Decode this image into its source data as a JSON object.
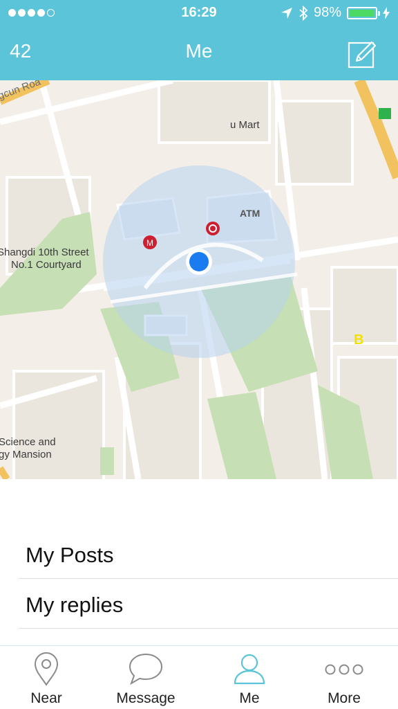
{
  "status_bar": {
    "time": "16:29",
    "battery": "98%",
    "battery_level": 0.98,
    "signal_dots_filled": 4,
    "signal_dots_total": 5,
    "icons": [
      "location-arrow-icon",
      "bluetooth-icon",
      "battery-icon",
      "charging-icon"
    ]
  },
  "nav": {
    "count": "42",
    "title": "Me",
    "compose_icon": "compose-icon"
  },
  "map": {
    "labels": {
      "road": "gcun Roa",
      "mart": "u Mart",
      "atm": "ATM",
      "street_line1": "Shangdi 10th Street",
      "street_line2": "No.1 Courtyard",
      "mansion_line1": "Science and",
      "mansion_line2": "gy Mansion",
      "poi_b": "B"
    }
  },
  "list": {
    "items": [
      {
        "label": "My Posts"
      },
      {
        "label": "My replies"
      }
    ]
  },
  "tabbar": {
    "tabs": [
      {
        "label": "Near",
        "icon": "map-pin-icon"
      },
      {
        "label": "Message",
        "icon": "chat-bubble-icon"
      },
      {
        "label": "Me",
        "icon": "user-icon",
        "active": true
      },
      {
        "label": "More",
        "icon": "more-dots-icon"
      }
    ]
  },
  "colors": {
    "brand": "#5bc4d8",
    "active_tab": "#5bc4d8",
    "location_dot": "#1a7cf0",
    "battery_fill": "#4cd964"
  }
}
